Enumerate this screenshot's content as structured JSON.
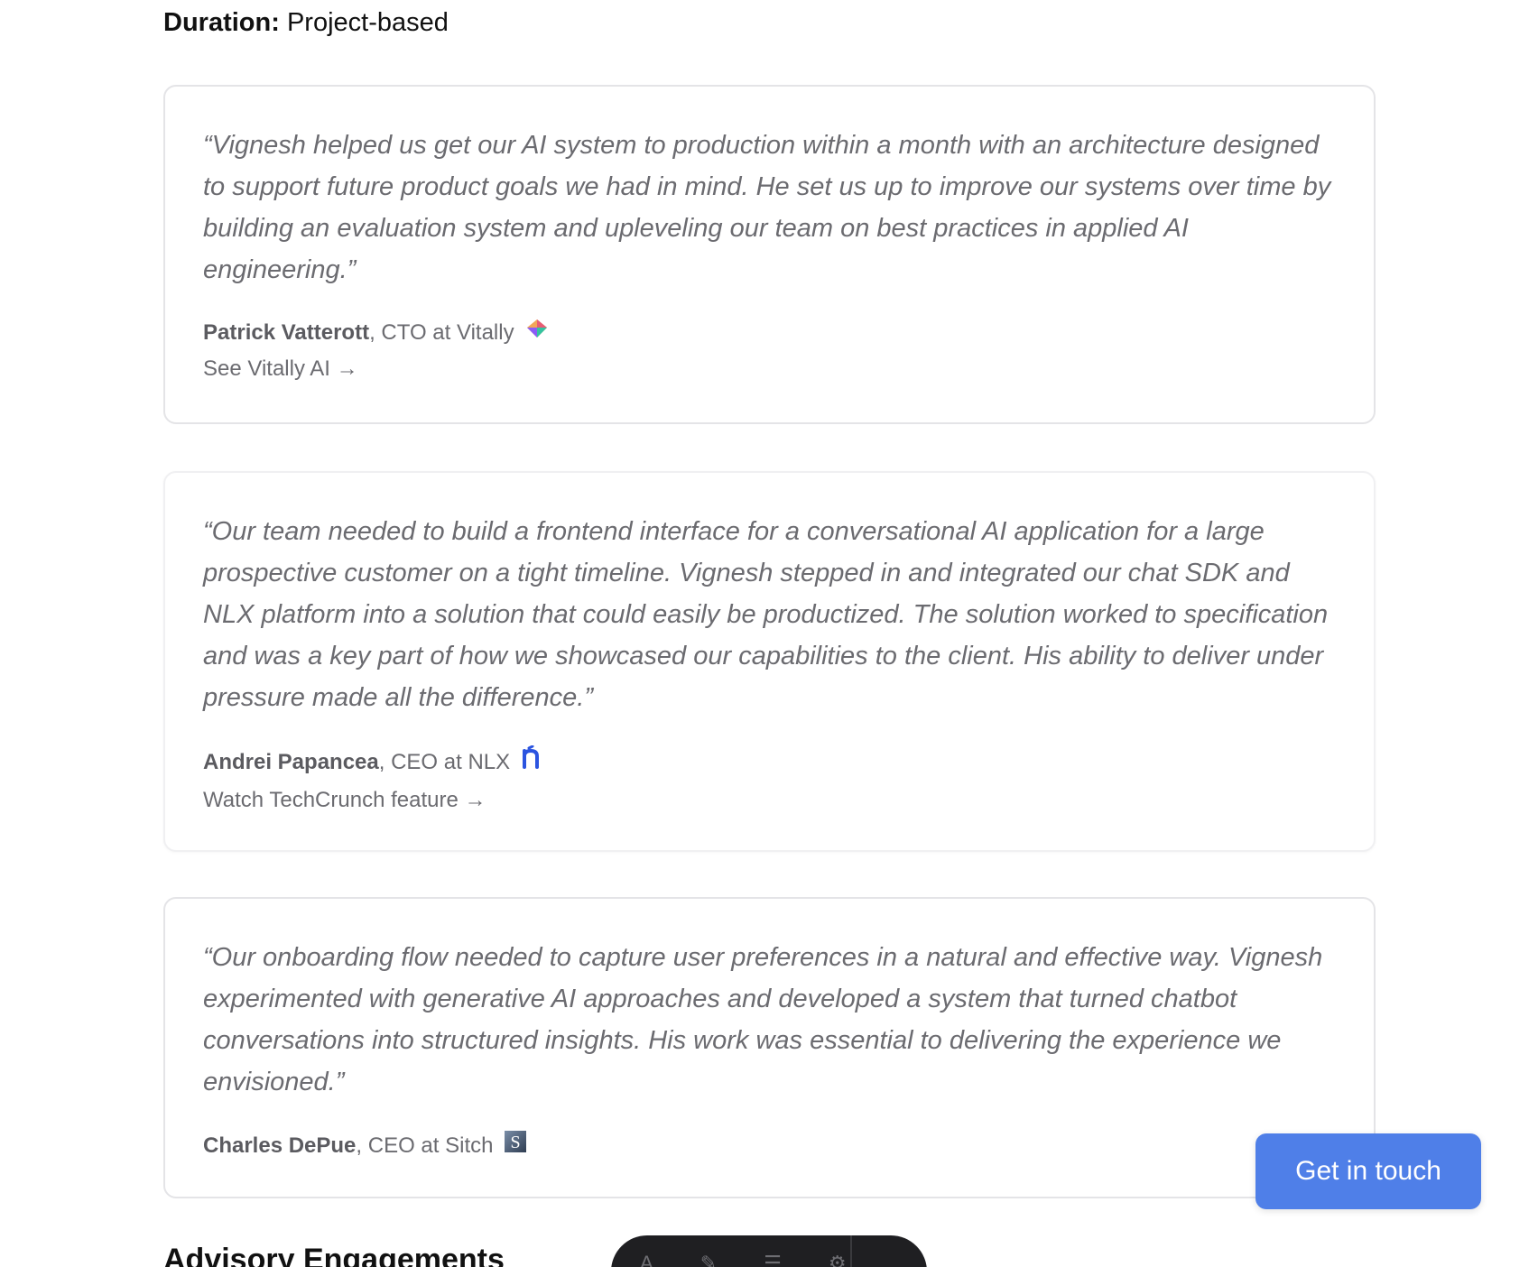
{
  "duration": {
    "label": "Duration:",
    "value": "Project-based"
  },
  "testimonials": [
    {
      "quote": "“Vignesh helped us get our AI system to production within a month with an architecture designed to support future product goals we had in mind. He set us up to improve our systems over time by building an evaluation system and upleveling our team on best practices in applied AI engineering.”",
      "name": "Patrick Vatterott",
      "role": ", CTO at Vitally",
      "logo_icon": "vitally-logo-icon",
      "link": "See Vitally AI →"
    },
    {
      "quote": "“Our team needed to build a frontend interface for a conversational AI application for a large prospective customer on a tight timeline. Vignesh stepped in and integrated our chat SDK and NLX platform into a solution that could easily be productized. The solution worked to specification and was a key part of how we showcased our capabilities to the client. His ability to deliver under pressure made all the difference.”",
      "name": "Andrei Papancea",
      "role": ", CEO at NLX",
      "logo_icon": "nlx-logo-icon",
      "link": "Watch TechCrunch feature →"
    },
    {
      "quote": "“Our onboarding flow needed to capture user preferences in a natural and effective way. Vignesh experimented with generative AI approaches and developed a system that turned chatbot conversations into structured insights. His work was essential to delivering the experience we envisioned.”",
      "name": "Charles DePue",
      "role": ", CEO at Sitch",
      "logo_icon": "sitch-logo-icon"
    }
  ],
  "cta": {
    "label": "Get in touch",
    "color": "#4f7fe8"
  },
  "next_section": {
    "heading": "Advisory Engagements"
  },
  "toolbar": {
    "icons": [
      "text-icon",
      "pen-icon",
      "list-icon",
      "settings-icon"
    ]
  },
  "colors": {
    "quote_text": "#6b6b70",
    "card_border": "#e4e4e7",
    "nlx_blue": "#2b54e0"
  }
}
